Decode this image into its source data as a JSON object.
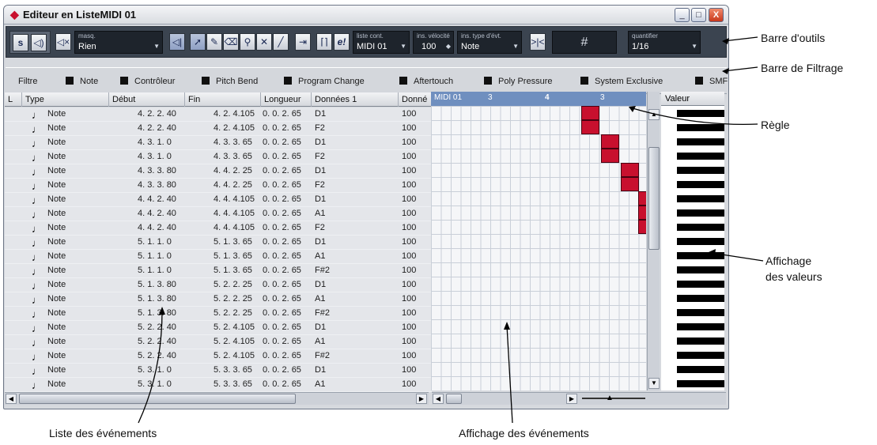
{
  "window": {
    "title": "Editeur en ListeMIDI 01",
    "minimize": "_",
    "maximize": "□",
    "close": "X"
  },
  "toolbar": {
    "solo_label": "s",
    "masq_label": "masq.",
    "masq_value": "Rien",
    "liste_label": "liste cont.",
    "liste_value": "MIDI 01",
    "velo_label": "ins. vélocité",
    "velo_value": "100",
    "type_label": "ins. type d'évt.",
    "type_value": "Note",
    "grid_symbol": "#",
    "quant_label": "quantifier",
    "quant_value": "1/16",
    "edit_label": "e!"
  },
  "filter": {
    "label": "Filtre",
    "items": [
      "Note",
      "Contrôleur",
      "Pitch Bend",
      "Program Change",
      "Aftertouch",
      "Poly Pressure",
      "System Exclusive",
      "SMF"
    ]
  },
  "list": {
    "headers": [
      "L",
      "Type",
      "Début",
      "Fin",
      "Longueur",
      "Données 1",
      "Donné"
    ],
    "rows": [
      [
        "Note",
        "4. 2. 2. 40",
        "4. 2. 4.105",
        "0. 0. 2. 65",
        "D1",
        "100"
      ],
      [
        "Note",
        "4. 2. 2. 40",
        "4. 2. 4.105",
        "0. 0. 2. 65",
        "F2",
        "100"
      ],
      [
        "Note",
        "4. 3. 1. 0",
        "4. 3. 3. 65",
        "0. 0. 2. 65",
        "D1",
        "100"
      ],
      [
        "Note",
        "4. 3. 1. 0",
        "4. 3. 3. 65",
        "0. 0. 2. 65",
        "F2",
        "100"
      ],
      [
        "Note",
        "4. 3. 3. 80",
        "4. 4. 2. 25",
        "0. 0. 2. 65",
        "D1",
        "100"
      ],
      [
        "Note",
        "4. 3. 3. 80",
        "4. 4. 2. 25",
        "0. 0. 2. 65",
        "F2",
        "100"
      ],
      [
        "Note",
        "4. 4. 2. 40",
        "4. 4. 4.105",
        "0. 0. 2. 65",
        "D1",
        "100"
      ],
      [
        "Note",
        "4. 4. 2. 40",
        "4. 4. 4.105",
        "0. 0. 2. 65",
        "A1",
        "100"
      ],
      [
        "Note",
        "4. 4. 2. 40",
        "4. 4. 4.105",
        "0. 0. 2. 65",
        "F2",
        "100"
      ],
      [
        "Note",
        "5. 1. 1. 0",
        "5. 1. 3. 65",
        "0. 0. 2. 65",
        "D1",
        "100"
      ],
      [
        "Note",
        "5. 1. 1. 0",
        "5. 1. 3. 65",
        "0. 0. 2. 65",
        "A1",
        "100"
      ],
      [
        "Note",
        "5. 1. 1. 0",
        "5. 1. 3. 65",
        "0. 0. 2. 65",
        "F#2",
        "100"
      ],
      [
        "Note",
        "5. 1. 3. 80",
        "5. 2. 2. 25",
        "0. 0. 2. 65",
        "D1",
        "100"
      ],
      [
        "Note",
        "5. 1. 3. 80",
        "5. 2. 2. 25",
        "0. 0. 2. 65",
        "A1",
        "100"
      ],
      [
        "Note",
        "5. 1. 3. 80",
        "5. 2. 2. 25",
        "0. 0. 2. 65",
        "F#2",
        "100"
      ],
      [
        "Note",
        "5. 2. 2. 40",
        "5. 2. 4.105",
        "0. 0. 2. 65",
        "D1",
        "100"
      ],
      [
        "Note",
        "5. 2. 2. 40",
        "5. 2. 4.105",
        "0. 0. 2. 65",
        "A1",
        "100"
      ],
      [
        "Note",
        "5. 2. 2. 40",
        "5. 2. 4.105",
        "0. 0. 2. 65",
        "F#2",
        "100"
      ],
      [
        "Note",
        "5. 3. 1. 0",
        "5. 3. 3. 65",
        "0. 0. 2. 65",
        "D1",
        "100"
      ],
      [
        "Note",
        "5. 3. 1. 0",
        "5. 3. 3. 65",
        "0. 0. 2. 65",
        "A1",
        "100"
      ]
    ]
  },
  "ruler": {
    "track": "MIDI 01",
    "marks": [
      "3",
      "4",
      "3"
    ]
  },
  "value_header": "Valeur",
  "callouts": {
    "toolbar": "Barre d'outils",
    "filter": "Barre de Filtrage",
    "ruler": "Règle",
    "values": [
      "Affichage",
      "des valeurs"
    ],
    "list": "Liste des événements",
    "events": "Affichage des événements"
  },
  "colors": {
    "event": "#c8102e",
    "toolbar": "#3b4450"
  }
}
